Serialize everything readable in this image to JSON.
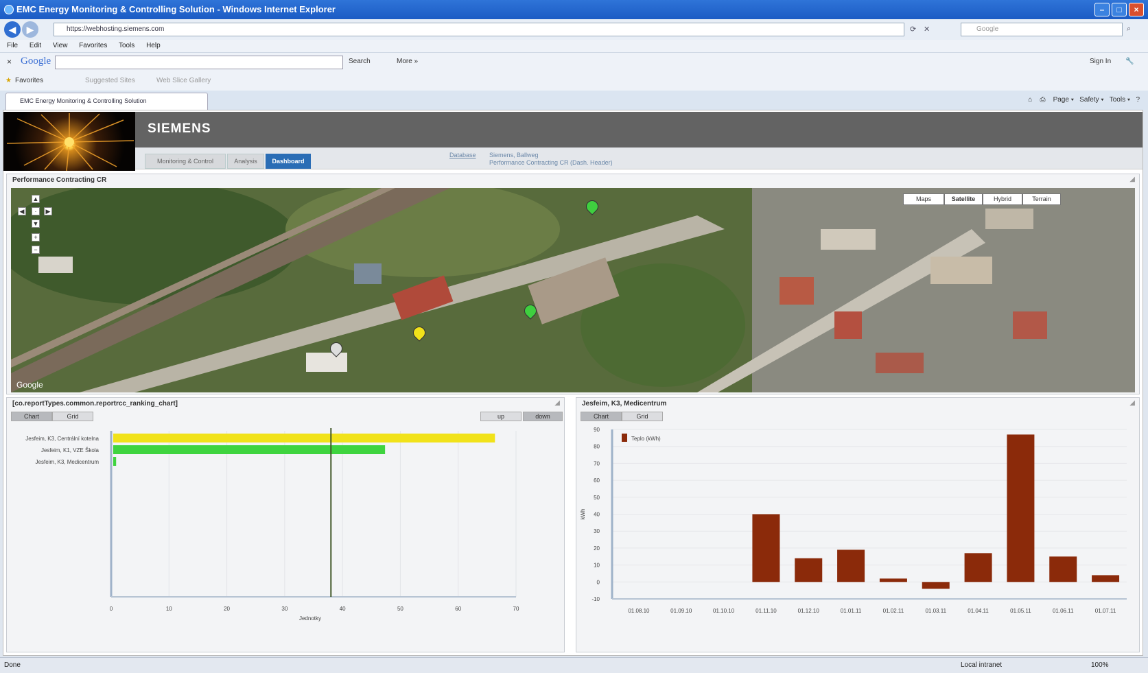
{
  "window": {
    "title": "EMC Energy Monitoring & Controlling Solution - Windows Internet Explorer"
  },
  "browser": {
    "url": "https://webhosting.siemens.com",
    "search_placeholder": "Google",
    "menu": [
      "File",
      "Edit",
      "View",
      "Favorites",
      "Tools",
      "Help"
    ],
    "google_logo": "Google",
    "google_search": "Search",
    "google_more": "More »",
    "sign_in": "Sign In",
    "favorites": "Favorites",
    "fav_items": [
      "Suggested Sites",
      "Web Slice Gallery"
    ],
    "tab_title": "EMC Energy Monitoring & Controlling Solution",
    "tools": [
      "Page",
      "Safety",
      "Tools"
    ],
    "status_left": "Done",
    "status_zone": "Local intranet",
    "zoom": "100%"
  },
  "app": {
    "brand": "SIEMENS",
    "nav_tabs": [
      "Monitoring & Control",
      "Analysis",
      "Dashboard"
    ],
    "active_tab": "Dashboard",
    "nav_link": "Database",
    "nav_info": [
      "Siemens, Ballweg",
      "Performance Contracting CR (Dash. Header)"
    ]
  },
  "map_panel": {
    "title": "Performance Contracting CR",
    "map_types": [
      "Maps",
      "Satellite",
      "Hybrid",
      "Terrain"
    ],
    "selected_type": "Satellite",
    "google_credit": "Google",
    "markers": [
      {
        "color": "#3fcf3f"
      },
      {
        "color": "#3fcf3f"
      },
      {
        "color": "#f1e21a"
      },
      {
        "color": "#dddddd"
      }
    ]
  },
  "ranking_panel": {
    "title": "[co.reportTypes.common.reportrcc_ranking_chart]",
    "view_buttons": [
      "Chart",
      "Grid"
    ],
    "sort_buttons": [
      "up",
      "down"
    ],
    "chart_data": {
      "type": "bar",
      "orientation": "horizontal",
      "categories": [
        "Jesfeim, K3, Centrální kotelna",
        "Jesfeim, K1, VZE Škola",
        "Jesfeim, K3, Medicentrum"
      ],
      "values": [
        66,
        47,
        0.5
      ],
      "colors": [
        "#f1e21a",
        "#3fd43f",
        "#3fd43f"
      ],
      "xlim": [
        0,
        70
      ],
      "xticks": [
        0,
        10,
        20,
        30,
        40,
        50,
        60,
        70
      ],
      "reference_line": 38,
      "xlabel": "Jednotky"
    }
  },
  "monthly_panel": {
    "title": "Jesfeim, K3, Medicentrum",
    "view_buttons": [
      "Chart",
      "Grid"
    ],
    "chart_data": {
      "type": "bar",
      "categories": [
        "01.08.10",
        "01.09.10",
        "01.10.10",
        "01.11.10",
        "01.12.10",
        "01.01.11",
        "01.02.11",
        "01.03.11",
        "01.04.11",
        "01.05.11",
        "01.06.11",
        "01.07.11"
      ],
      "series": [
        {
          "name": "Teplo (kWh)",
          "color": "#8b2a0a",
          "values": [
            0,
            0,
            0,
            40,
            14,
            19,
            2,
            -4,
            17,
            87,
            15,
            4
          ]
        }
      ],
      "ylim": [
        -10,
        90
      ],
      "yticks": [
        -10,
        0,
        10,
        20,
        30,
        40,
        50,
        60,
        70,
        80,
        90
      ],
      "ylabel": "kWh",
      "legend": "top-left",
      "grid": true
    }
  }
}
